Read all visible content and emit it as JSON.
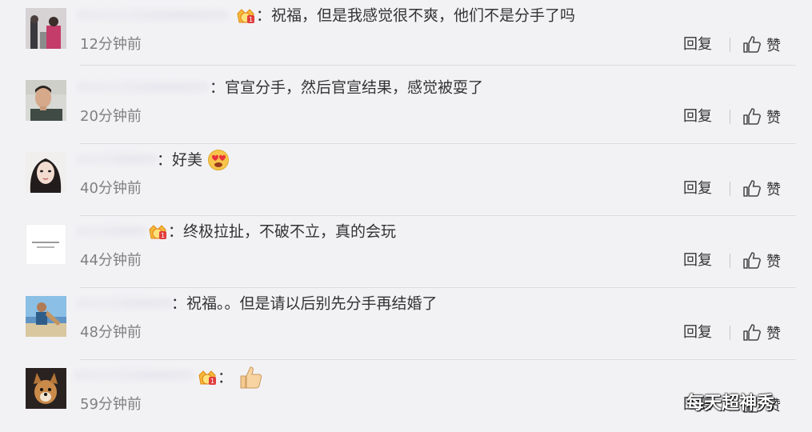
{
  "comments": [
    {
      "text": "：祝福，但是我感觉很不爽，他们不是分手了吗",
      "time": "12分钟前",
      "vip": true
    },
    {
      "text": "：官宣分手，然后官宣结果，感觉被耍了",
      "time": "20分钟前",
      "vip": false
    },
    {
      "text": "：好美",
      "time": "40分钟前",
      "vip": false,
      "emoji": "heart-eyes-emoji"
    },
    {
      "text": "：终极拉扯，不破不立，真的会玩",
      "time": "44分钟前",
      "vip": true
    },
    {
      "text": "：祝福。。但是请以后别先分手再结婚了",
      "time": "48分钟前",
      "vip": false
    },
    {
      "text": "：",
      "time": "59分钟前",
      "vip": true,
      "emoji": "thumbs-up-emoji"
    }
  ],
  "actions": {
    "reply": "回复",
    "like": "赞"
  },
  "watermark": "每天超神秀",
  "colors": {
    "background": "#f2f2f5",
    "time": "#808080",
    "vip": "#e8a317",
    "emoji_yellow": "#f7c54a"
  }
}
